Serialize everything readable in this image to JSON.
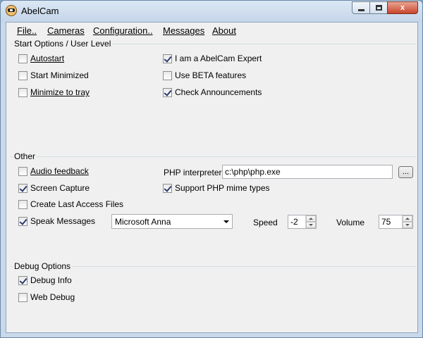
{
  "window": {
    "title": "AbelCam",
    "icon": "abelcam-app-icon",
    "close_label": "x"
  },
  "menu": {
    "file": "File..",
    "cameras": "Cameras",
    "configuration": "Configuration..",
    "messages": "Messages",
    "about": "About"
  },
  "start_options": {
    "label": "Start Options / User Level",
    "autostart": {
      "label": "Autostart",
      "checked": false
    },
    "start_minimized": {
      "label": "Start Minimized",
      "checked": false
    },
    "minimize_to_tray": {
      "label": "Minimize to tray",
      "checked": false
    },
    "abelcam_expert": {
      "label": "I am a AbelCam Expert",
      "checked": true
    },
    "use_beta": {
      "label": "Use BETA features",
      "checked": false
    },
    "check_announcements": {
      "label": "Check Announcements",
      "checked": true
    }
  },
  "other": {
    "label": "Other",
    "audio_feedback": {
      "label": "Audio feedback",
      "checked": false
    },
    "screen_capture": {
      "label": "Screen Capture",
      "checked": true
    },
    "create_last_access": {
      "label": "Create Last Access Files",
      "checked": false
    },
    "speak_messages": {
      "label": "Speak Messages",
      "checked": true
    },
    "php_interpreter_label": "PHP interpreter",
    "php_interpreter_value": "c:\\php\\php.exe",
    "browse_label": "...",
    "support_php_mime": {
      "label": "Support PHP mime types",
      "checked": true
    },
    "voice_selected": "Microsoft Anna",
    "speed_label": "Speed",
    "speed_value": "-2",
    "volume_label": "Volume",
    "volume_value": "75"
  },
  "debug": {
    "label": "Debug Options",
    "debug_info": {
      "label": "Debug Info",
      "checked": true
    },
    "web_debug": {
      "label": "Web Debug",
      "checked": false
    }
  }
}
